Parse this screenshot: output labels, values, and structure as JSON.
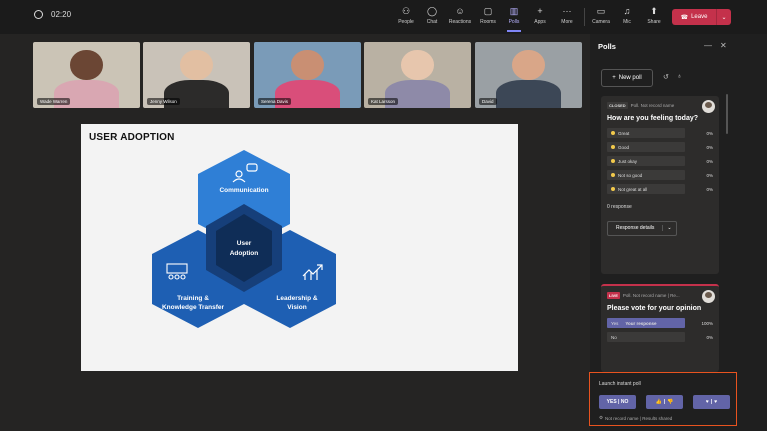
{
  "meeting": {
    "timer": "02:20"
  },
  "toolbar": {
    "items": [
      {
        "label": "People",
        "icon": "people-icon",
        "glyph": "⚇"
      },
      {
        "label": "Chat",
        "icon": "chat-icon",
        "glyph": "◯"
      },
      {
        "label": "Reactions",
        "icon": "reactions-icon",
        "glyph": "☺"
      },
      {
        "label": "Rooms",
        "icon": "rooms-icon",
        "glyph": "▢"
      },
      {
        "label": "Polls",
        "icon": "polls-icon",
        "glyph": "▥"
      },
      {
        "label": "Apps",
        "icon": "apps-icon",
        "glyph": "+"
      },
      {
        "label": "More",
        "icon": "more-icon",
        "glyph": "···"
      },
      {
        "label": "Camera",
        "icon": "camera-icon",
        "glyph": "▭"
      },
      {
        "label": "Mic",
        "icon": "mic-icon",
        "glyph": "♫"
      },
      {
        "label": "Share",
        "icon": "share-icon",
        "glyph": "⬆"
      }
    ],
    "leave_label": "Leave",
    "leave_color": "#c4314b",
    "accent": "#7f85f5"
  },
  "participants": [
    {
      "name": "Wade Warren",
      "bg": "#cbc4b6",
      "skin": "#6b4634",
      "shirt": "#d9a7b2"
    },
    {
      "name": "Jenny Wilson",
      "bg": "#c9c2b8",
      "skin": "#e2bfa2",
      "shirt": "#2c2b2a"
    },
    {
      "name": "Serena Davis",
      "bg": "#7a9bb8",
      "skin": "#c98f73",
      "shirt": "#d94e7a"
    },
    {
      "name": "Kat Larsson",
      "bg": "#b9b1a3",
      "skin": "#e7c6ad",
      "shirt": "#8e8aa8"
    },
    {
      "name": "David",
      "bg": "#9aa0a4",
      "skin": "#d9a688",
      "shirt": "#3c4756"
    }
  ],
  "slide": {
    "title": "USER ADOPTION",
    "center": [
      "User",
      "Adoption"
    ],
    "top": "Communication",
    "left": [
      "Training &",
      "Knowledge Transfer"
    ],
    "right": [
      "Leadership &",
      "Vision"
    ]
  },
  "polls_panel": {
    "title": "Polls",
    "new_poll": "New poll",
    "closed_poll": {
      "status": "CLOSED",
      "meta": "Poll. Not record name",
      "question": "How are you feeling today?",
      "options": [
        {
          "label": "Great",
          "pct": "0%"
        },
        {
          "label": "Good",
          "pct": "0%"
        },
        {
          "label": "Just okay",
          "pct": "0%"
        },
        {
          "label": "Not so good",
          "pct": "0%"
        },
        {
          "label": "Not great at all",
          "pct": "0%"
        }
      ],
      "responses": "0 response",
      "details_button": "Response details"
    },
    "live_poll": {
      "status": "LIVE",
      "meta": "Poll. Not record name | Re...",
      "question": "Please vote for your opinion",
      "options": [
        {
          "label": "Yes",
          "tag": "Your response",
          "pct": "100%"
        },
        {
          "label": "No",
          "tag": "",
          "pct": "0%"
        }
      ]
    },
    "instant": {
      "title": "Launch instant poll",
      "yes_no": "YES | NO",
      "footer": "Not record name | Results shared"
    }
  }
}
